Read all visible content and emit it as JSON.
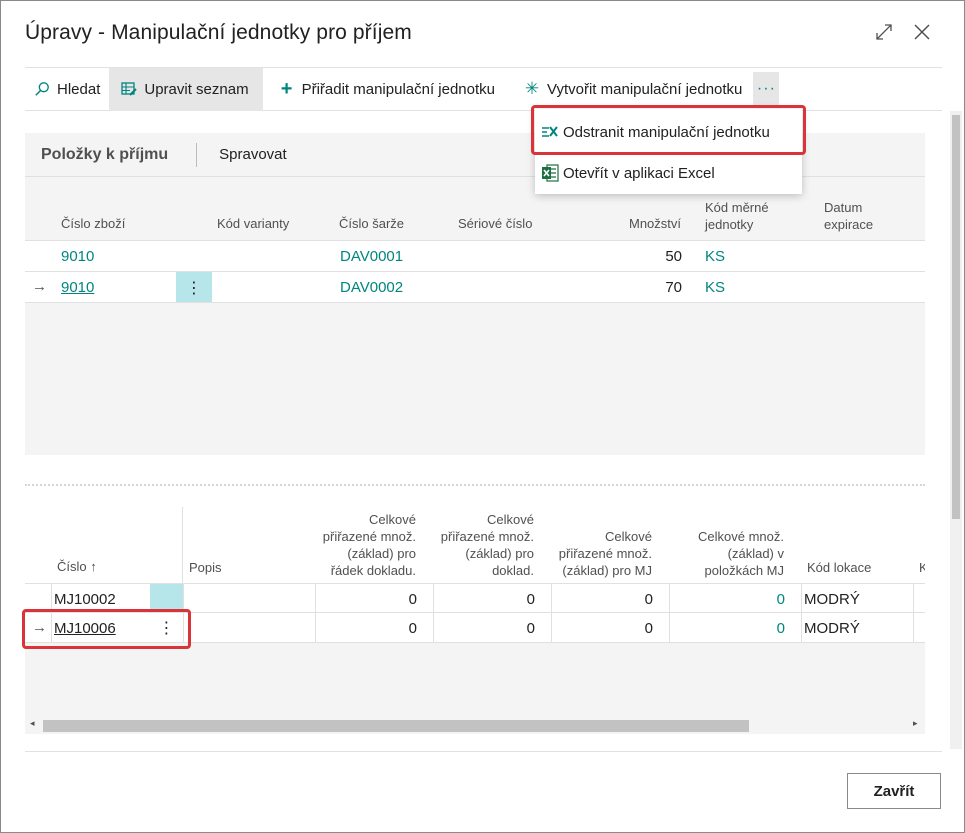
{
  "dialog": {
    "title": "Úpravy - Manipulační jednotky pro příjem",
    "expand_icon": "expand-icon",
    "close_icon": "close-icon"
  },
  "actionbar": {
    "search": "Hledat",
    "edit_list": "Upravit seznam",
    "assign": "Přiřadit manipulační jednotku",
    "create": "Vytvořit manipulační jednotku",
    "more": "···"
  },
  "menu": {
    "remove": "Odstranit manipulační jednotku",
    "excel": "Otevřít v aplikaci Excel"
  },
  "part1": {
    "title": "Položky k příjmu",
    "manage": "Spravovat",
    "columns": {
      "item_no": "Číslo zboží",
      "variant": "Kód varianty",
      "lot": "Číslo šarže",
      "serial": "Sériové číslo",
      "qty": "Množství",
      "uom_1": "Kód měrné",
      "uom_2": "jednotky",
      "exp_1": "Datum",
      "exp_2": "expirace"
    },
    "rows": [
      {
        "item_no": "9010",
        "lot": "DAV0001",
        "qty": "50",
        "uom": "KS"
      },
      {
        "item_no": "9010",
        "lot": "DAV0002",
        "qty": "70",
        "uom": "KS"
      }
    ]
  },
  "part2": {
    "columns": {
      "no": "Číslo",
      "sort_icon": "↑",
      "desc": "Popis",
      "c1": [
        "Celkové",
        "přiřazené množ.",
        "(základ) pro",
        "řádek dokladu."
      ],
      "c2": [
        "Celkové",
        "přiřazené množ.",
        "(základ) pro",
        "doklad."
      ],
      "c3": [
        "Celkové",
        "přiřazené množ.",
        "(základ) pro MJ"
      ],
      "c4": [
        "Celkové množ.",
        "(základ) v",
        "položkách MJ"
      ],
      "loc": "Kód lokace",
      "next": "K"
    },
    "rows": [
      {
        "no": "MJ10002",
        "c1": "0",
        "c2": "0",
        "c3": "0",
        "c4": "0",
        "loc": "MODRÝ"
      },
      {
        "no": "MJ10006",
        "c1": "0",
        "c2": "0",
        "c3": "0",
        "c4": "0",
        "loc": "MODRÝ"
      }
    ]
  },
  "footer": {
    "close": "Zavřít"
  },
  "colors": {
    "accent": "#00857d",
    "highlight": "#d9343a",
    "row_select": "#b6e6ea"
  }
}
